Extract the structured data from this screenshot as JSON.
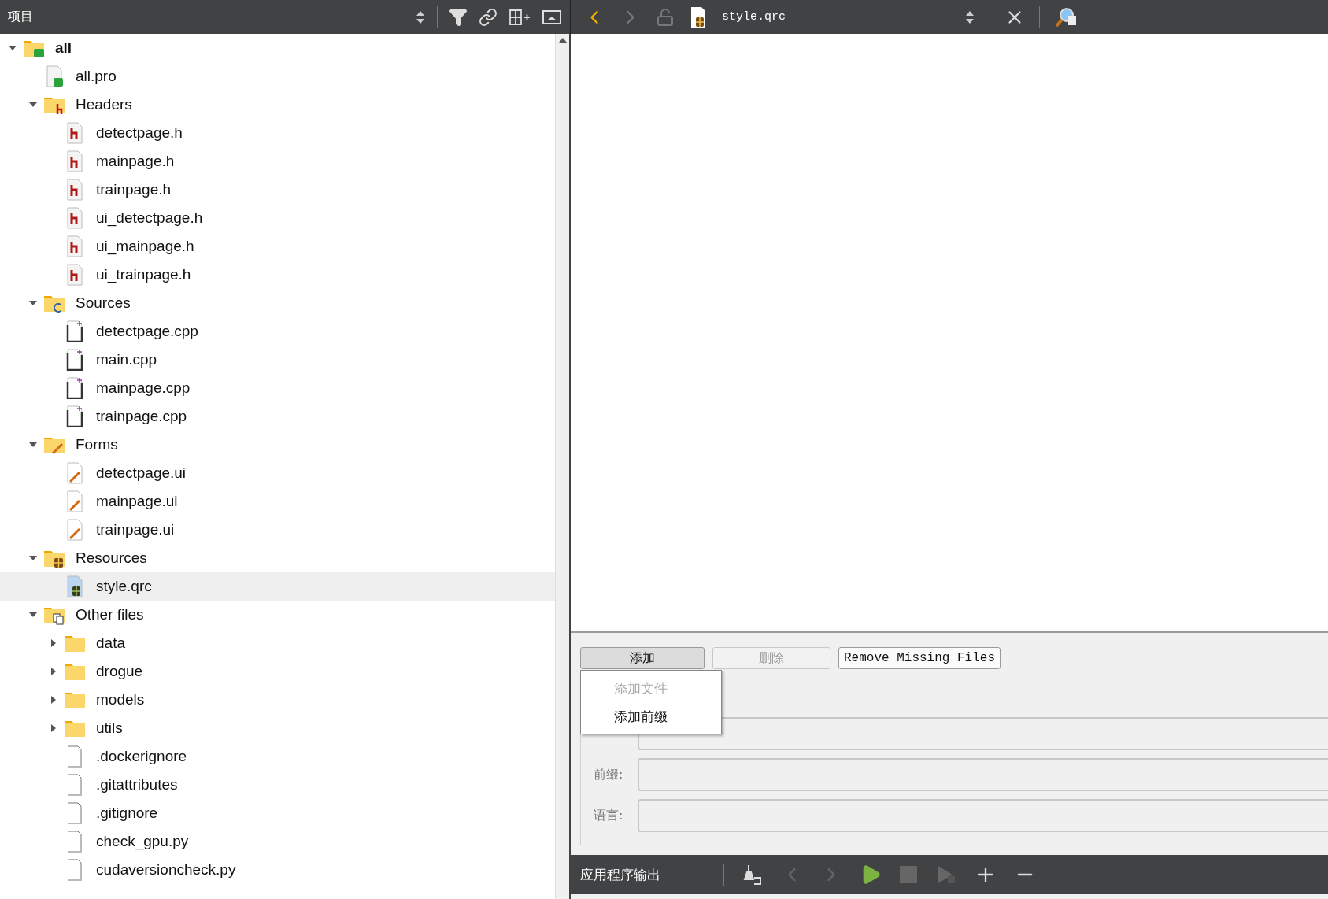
{
  "project_pane": {
    "title": "项目"
  },
  "tree": [
    {
      "label": "all",
      "kind": "project",
      "expanded": true,
      "selected": false,
      "children": [
        {
          "label": "all.pro",
          "kind": "pro",
          "selected": false
        },
        {
          "label": "Headers",
          "kind": "header-folder",
          "expanded": true,
          "selected": false,
          "children": [
            {
              "label": "detectpage.h",
              "kind": "header",
              "selected": false
            },
            {
              "label": "mainpage.h",
              "kind": "header",
              "selected": false
            },
            {
              "label": "trainpage.h",
              "kind": "header",
              "selected": false
            },
            {
              "label": "ui_detectpage.h",
              "kind": "header",
              "selected": false
            },
            {
              "label": "ui_mainpage.h",
              "kind": "header",
              "selected": false
            },
            {
              "label": "ui_trainpage.h",
              "kind": "header",
              "selected": false
            }
          ]
        },
        {
          "label": "Sources",
          "kind": "source-folder",
          "expanded": true,
          "selected": false,
          "children": [
            {
              "label": "detectpage.cpp",
              "kind": "source",
              "selected": false
            },
            {
              "label": "main.cpp",
              "kind": "source",
              "selected": false
            },
            {
              "label": "mainpage.cpp",
              "kind": "source",
              "selected": false
            },
            {
              "label": "trainpage.cpp",
              "kind": "source",
              "selected": false
            }
          ]
        },
        {
          "label": "Forms",
          "kind": "form-folder",
          "expanded": true,
          "selected": false,
          "children": [
            {
              "label": "detectpage.ui",
              "kind": "form",
              "selected": false
            },
            {
              "label": "mainpage.ui",
              "kind": "form",
              "selected": false
            },
            {
              "label": "trainpage.ui",
              "kind": "form",
              "selected": false
            }
          ]
        },
        {
          "label": "Resources",
          "kind": "resource-folder",
          "expanded": true,
          "selected": false,
          "children": [
            {
              "label": "style.qrc",
              "kind": "resource",
              "selected": true
            }
          ]
        },
        {
          "label": "Other files",
          "kind": "other-folder",
          "expanded": true,
          "selected": false,
          "children": [
            {
              "label": "data",
              "kind": "folder",
              "expanded": false,
              "selected": false
            },
            {
              "label": "drogue",
              "kind": "folder",
              "expanded": false,
              "selected": false
            },
            {
              "label": "models",
              "kind": "folder",
              "expanded": false,
              "selected": false
            },
            {
              "label": "utils",
              "kind": "folder",
              "expanded": false,
              "selected": false
            },
            {
              "label": ".dockerignore",
              "kind": "file",
              "selected": false
            },
            {
              "label": ".gitattributes",
              "kind": "file",
              "selected": false
            },
            {
              "label": ".gitignore",
              "kind": "file",
              "selected": false
            },
            {
              "label": "check_gpu.py",
              "kind": "file",
              "selected": false
            },
            {
              "label": "cudaversioncheck.py",
              "kind": "file",
              "selected": false
            }
          ]
        }
      ]
    }
  ],
  "editor": {
    "file_name": "style.qrc"
  },
  "resource_panel": {
    "buttons": [
      {
        "label": "添加",
        "kind": "dropdown",
        "disabled": false
      },
      {
        "label": "删除",
        "kind": "plain",
        "disabled": true
      },
      {
        "label": "Remove Missing Files",
        "kind": "mono",
        "disabled": false
      }
    ],
    "menu": [
      {
        "label": "添加文件",
        "disabled": true
      },
      {
        "label": "添加前缀",
        "disabled": false
      }
    ],
    "fields": [
      {
        "label": "前缀:"
      },
      {
        "label": "语言:"
      }
    ]
  },
  "output_bar": {
    "title": "应用程序输出"
  }
}
